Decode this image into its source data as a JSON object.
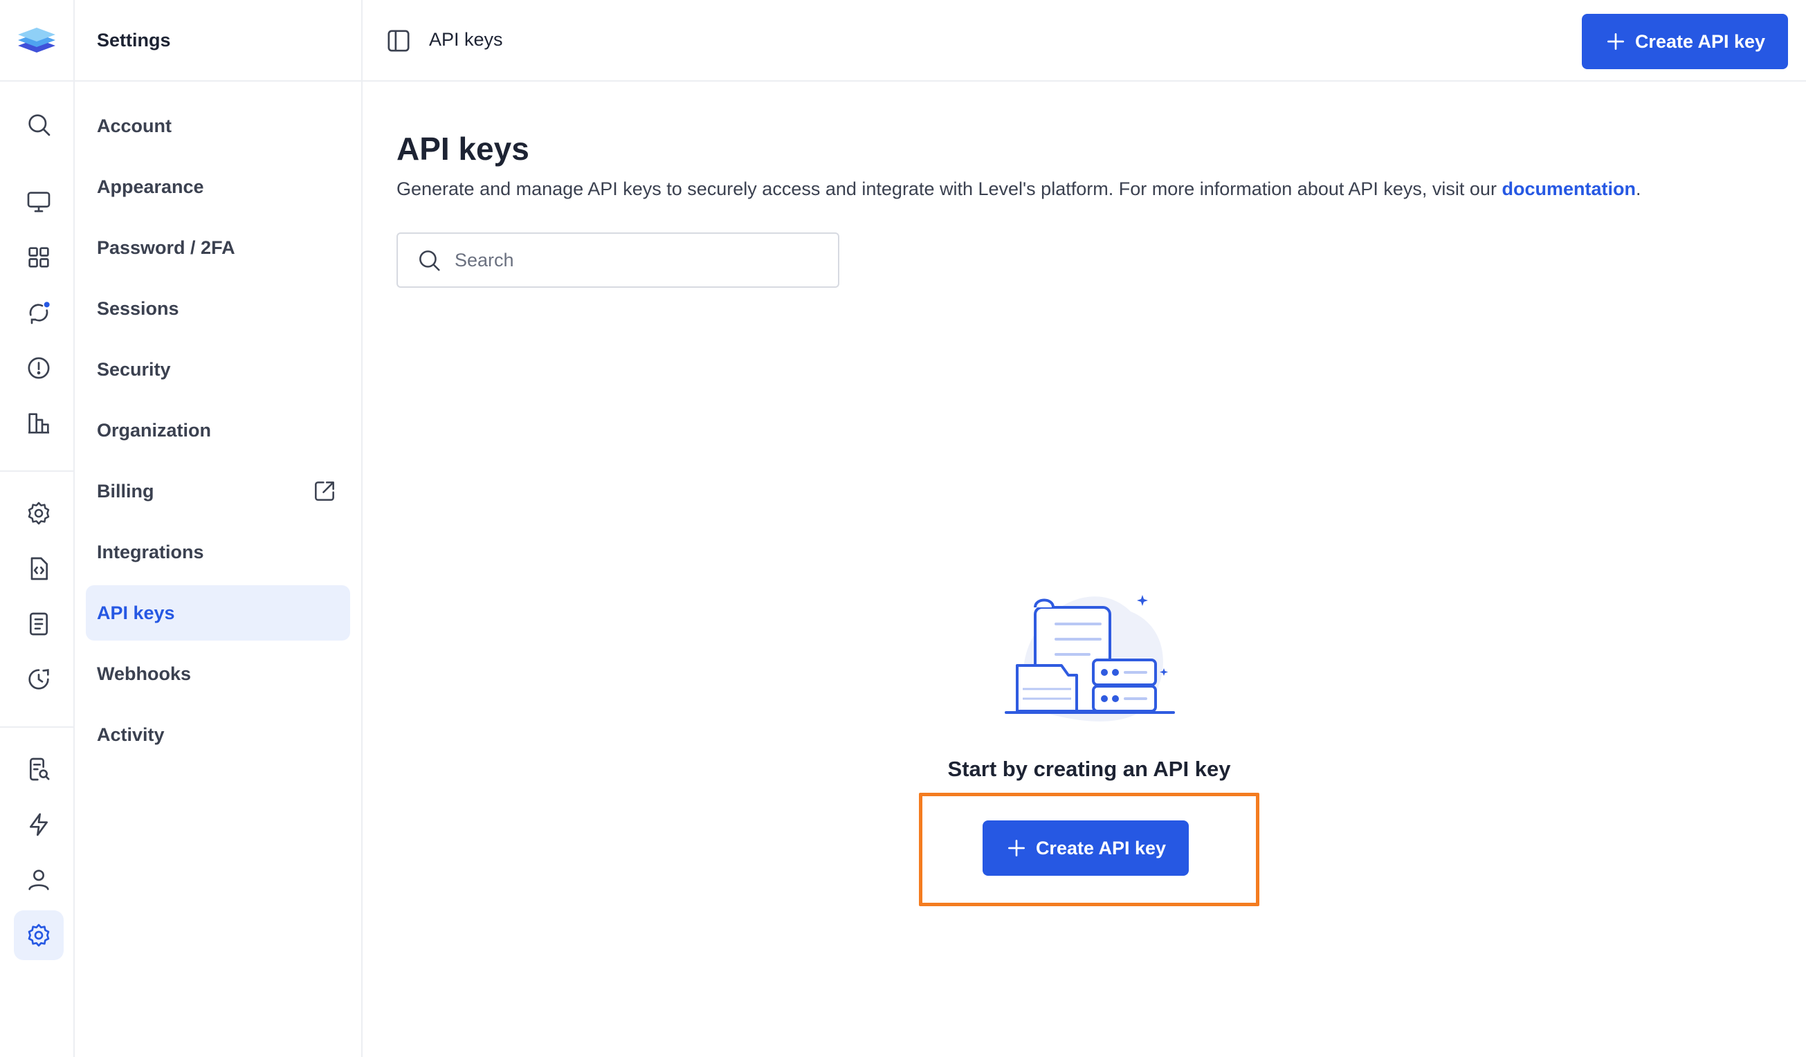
{
  "app": {
    "logo": "layers-logo"
  },
  "rail": {
    "icons": [
      {
        "name": "search-icon"
      },
      {
        "name": "monitor-icon"
      },
      {
        "name": "apps-grid-icon"
      },
      {
        "name": "sync-notification-icon"
      },
      {
        "name": "alert-circle-icon"
      },
      {
        "name": "buildings-chart-icon"
      },
      {
        "name": "gear-play-icon"
      },
      {
        "name": "code-file-icon"
      },
      {
        "name": "document-icon"
      },
      {
        "name": "history-clock-icon"
      },
      {
        "name": "document-search-icon"
      },
      {
        "name": "lightning-icon"
      },
      {
        "name": "user-icon"
      },
      {
        "name": "settings-gear-icon",
        "active": true
      }
    ]
  },
  "sidebar": {
    "title": "Settings",
    "items": [
      {
        "label": "Account"
      },
      {
        "label": "Appearance"
      },
      {
        "label": "Password / 2FA"
      },
      {
        "label": "Sessions"
      },
      {
        "label": "Security"
      },
      {
        "label": "Organization"
      },
      {
        "label": "Billing",
        "external": true
      },
      {
        "label": "Integrations"
      },
      {
        "label": "API keys",
        "active": true
      },
      {
        "label": "Webhooks"
      },
      {
        "label": "Activity"
      }
    ]
  },
  "topbar": {
    "title": "API keys",
    "create_button": "Create API key"
  },
  "main": {
    "title": "API keys",
    "description": "Generate and manage API keys to securely access and integrate with Level's platform. For more information about API keys, visit our ",
    "doc_link": "documentation",
    "description_end": ".",
    "search_placeholder": "Search",
    "empty_state": {
      "message": "Start by creating an API key",
      "button": "Create API key"
    }
  },
  "colors": {
    "accent": "#2658e3",
    "highlight": "#f47c20",
    "active_bg": "#eaf0fd"
  }
}
